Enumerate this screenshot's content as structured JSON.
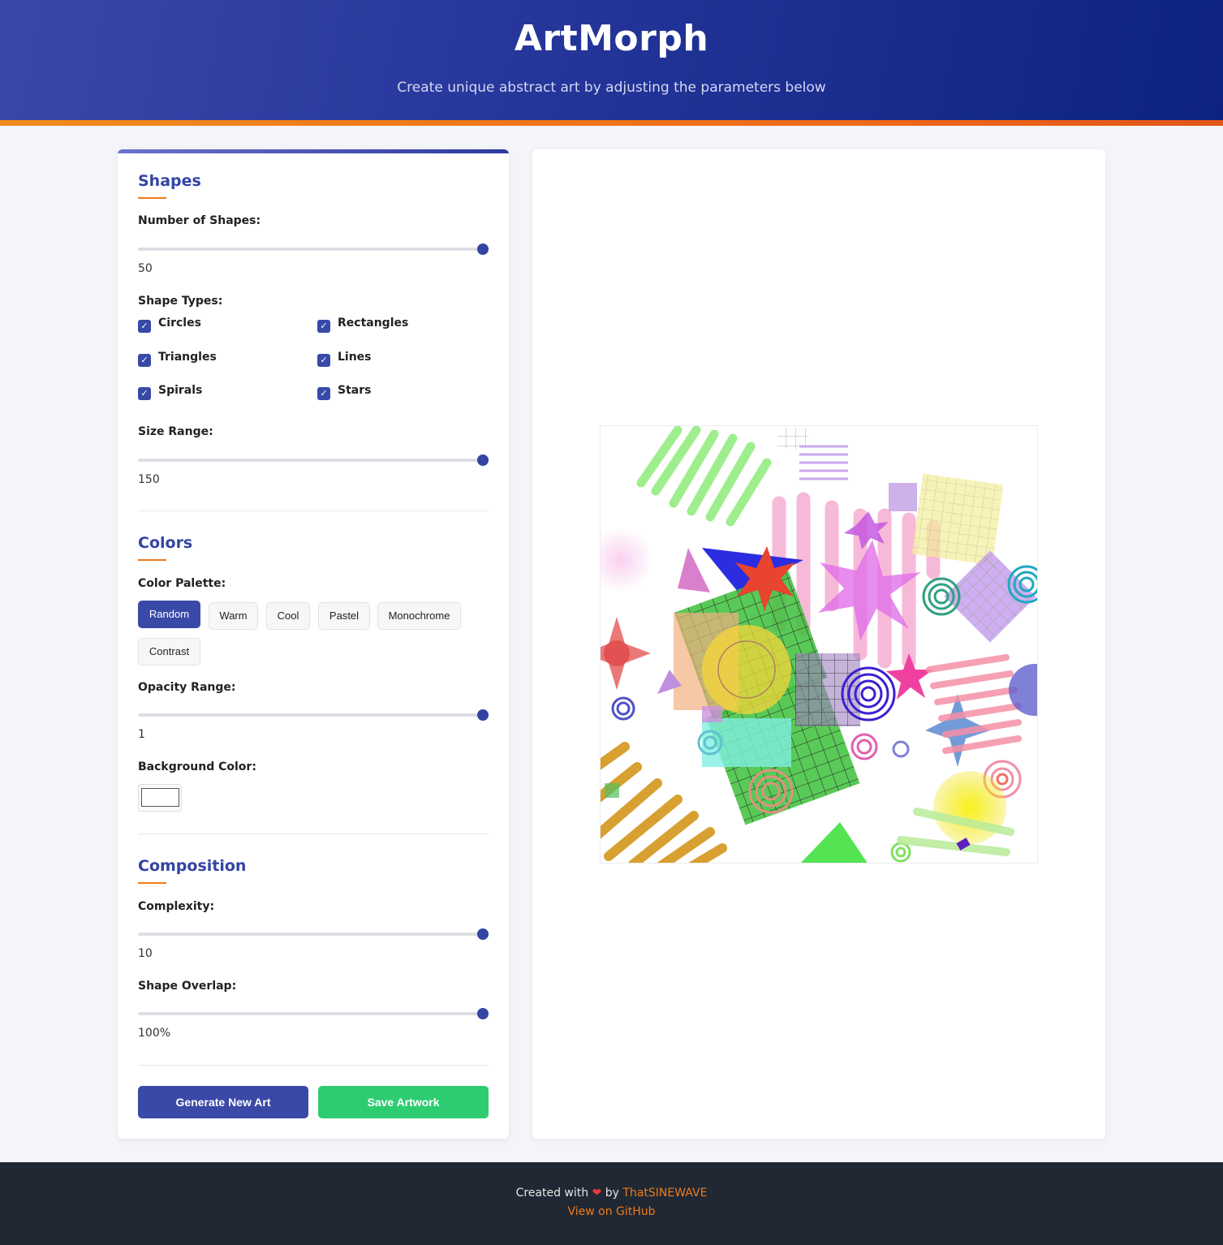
{
  "header": {
    "title": "ArtMorph",
    "subtitle": "Create unique abstract art by adjusting the parameters below"
  },
  "shapes": {
    "title": "Shapes",
    "num_label": "Number of Shapes:",
    "num_value": "50",
    "num_fraction": 1.0,
    "types_label": "Shape Types:",
    "types": [
      {
        "label": "Circles",
        "checked": true
      },
      {
        "label": "Rectangles",
        "checked": true
      },
      {
        "label": "Triangles",
        "checked": true
      },
      {
        "label": "Lines",
        "checked": true
      },
      {
        "label": "Spirals",
        "checked": true
      },
      {
        "label": "Stars",
        "checked": true
      }
    ],
    "size_label": "Size Range:",
    "size_value": "150",
    "size_fraction": 1.0
  },
  "colors": {
    "title": "Colors",
    "palette_label": "Color Palette:",
    "palettes": [
      "Random",
      "Warm",
      "Cool",
      "Pastel",
      "Monochrome",
      "Contrast"
    ],
    "active_palette": "Random",
    "opacity_label": "Opacity Range:",
    "opacity_value": "1",
    "opacity_fraction": 1.0,
    "bg_label": "Background Color:",
    "bg_color": "#ffffff"
  },
  "composition": {
    "title": "Composition",
    "complexity_label": "Complexity:",
    "complexity_value": "10",
    "complexity_fraction": 1.0,
    "overlap_label": "Shape Overlap:",
    "overlap_value": "100%",
    "overlap_fraction": 1.0
  },
  "actions": {
    "generate_label": "Generate New Art",
    "save_label": "Save Artwork",
    "generate_color": "#3a49a6",
    "save_color": "#2ecc71"
  },
  "footer": {
    "created_with": "Created with",
    "by": "by",
    "author": "ThatSINEWAVE",
    "github_link": "View on GitHub"
  },
  "colors_theme": {
    "accent": "#3444a3",
    "orange": "#f07a1a"
  }
}
